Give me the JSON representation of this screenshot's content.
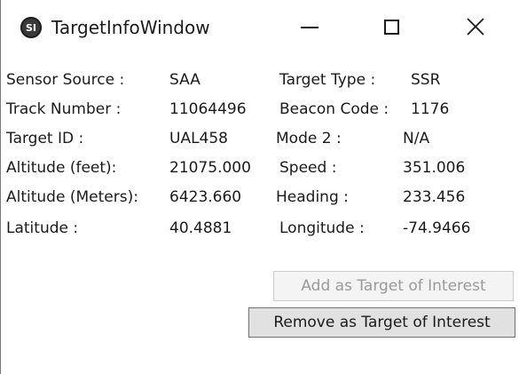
{
  "window": {
    "title": "TargetInfoWindow",
    "app_icon": "target-app-icon",
    "controls": {
      "minimize_icon": "minimize-icon",
      "maximize_icon": "maximize-icon",
      "close_icon": "close-icon"
    }
  },
  "fields": {
    "sensor_source": {
      "label": "Sensor Source :",
      "value": "SAA"
    },
    "target_type": {
      "label": "Target Type :",
      "value": "SSR"
    },
    "track_number": {
      "label": "Track Number :",
      "value": "11064496"
    },
    "beacon_code": {
      "label": "Beacon Code :",
      "value": "1176"
    },
    "target_id": {
      "label": "Target ID :",
      "value": "UAL458"
    },
    "mode_2": {
      "label": "Mode 2 :",
      "value": "N/A"
    },
    "altitude_feet": {
      "label": "Altitude (feet):",
      "value": "21075.000"
    },
    "speed": {
      "label": "Speed :",
      "value": "351.006"
    },
    "altitude_meters": {
      "label": "Altitude (Meters):",
      "value": "6423.660"
    },
    "heading": {
      "label": "Heading :",
      "value": "233.456"
    },
    "latitude": {
      "label": "Latitude :",
      "value": "40.4881"
    },
    "longitude": {
      "label": "Longitude :",
      "value": "-74.9466"
    }
  },
  "buttons": {
    "add_target": {
      "label": "Add as Target of Interest",
      "enabled": false
    },
    "remove_target": {
      "label": "Remove as Target of Interest",
      "enabled": true
    }
  },
  "colors": {
    "text": "#1b1b1b",
    "disabled_text": "#9a9a9a",
    "button_face": "#e1e1e1",
    "button_border": "#707070"
  }
}
